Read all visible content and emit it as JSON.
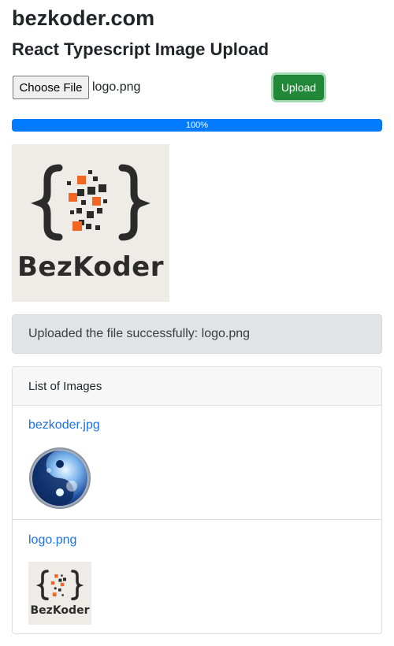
{
  "header": {
    "site_title": "bezkoder.com",
    "page_title": "React Typescript Image Upload"
  },
  "uploader": {
    "choose_label": "Choose File",
    "selected_file": "logo.png",
    "upload_label": "Upload"
  },
  "progress": {
    "value": 100,
    "label": "100%"
  },
  "preview": {
    "logo_text": "BezKoder"
  },
  "alert": {
    "message": "Uploaded the file successfully: logo.png"
  },
  "images_list": {
    "title": "List of Images",
    "items": [
      {
        "name": "bezkoder.jpg"
      },
      {
        "name": "logo.png",
        "logo_text": "BezKoder"
      }
    ]
  },
  "colors": {
    "primary": "#007bff",
    "success": "#218838",
    "link": "#1a73e8",
    "logo_orange": "#f26522",
    "logo_dark": "#2b2b2b"
  }
}
